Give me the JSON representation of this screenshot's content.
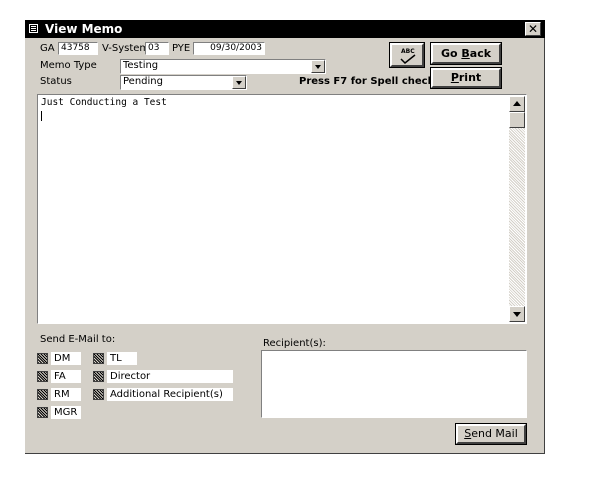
{
  "window": {
    "title": "View Memo",
    "close_glyph": "✕"
  },
  "header": {
    "ga_label": "GA",
    "ga_value": "43758",
    "vsystem_label": "V-System",
    "vsystem_value": "03",
    "pye_label": "PYE",
    "pye_value": "09/30/2003"
  },
  "memo_type": {
    "label": "Memo Type",
    "value": "Testing"
  },
  "status": {
    "label": "Status",
    "value": "Pending"
  },
  "buttons": {
    "go_back_pre": "Go ",
    "go_back_u": "B",
    "go_back_post": "ack",
    "print_u": "P",
    "print_post": "rint",
    "send_mail_u": "S",
    "send_mail_post": "end Mail"
  },
  "spell": {
    "abc": "ABC",
    "hint": "Press F7 for Spell check"
  },
  "memo": {
    "text": "Just Conducting a Test"
  },
  "email": {
    "label": "Send E-Mail to:",
    "options": [
      "DM",
      "TL",
      "FA",
      "Director",
      "RM",
      "Additional Recipient(s)",
      "MGR"
    ]
  },
  "recipients": {
    "label": "Recipient(s):",
    "value": ""
  }
}
